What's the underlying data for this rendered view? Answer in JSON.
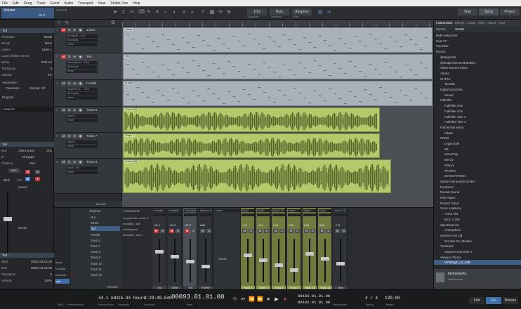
{
  "menu": [
    "File",
    "Edit",
    "Song",
    "Track",
    "Event",
    "Audio",
    "Transport",
    "View",
    "Studio One",
    "Help"
  ],
  "toolbar": {
    "inspector_track": "Volume",
    "inspector_value": "-21.2",
    "control_label": "Cmd/ctl",
    "quantize_value": "1/16",
    "quantize_label": "Quantize",
    "timebase_value": "Bars",
    "timebase_label": "Timebase",
    "snap_value": "Adaptive",
    "snap_label": "Snap",
    "start": "Start",
    "song": "Song",
    "project": "Project"
  },
  "inspector": {
    "track_name": "Ted",
    "rows": [
      {
        "k": "Timebase",
        "v": "Beats"
      },
      {
        "k": "Group",
        "v": "None"
      },
      {
        "k": "Layers",
        "v": "Layer 1"
      },
      {
        "k": "Layers follow events",
        "v": ""
      },
      {
        "k": "Delay",
        "v": "0.00 ms"
      },
      {
        "k": "Transpose",
        "v": "0"
      },
      {
        "k": "Velocity",
        "v": "0%"
      }
    ],
    "automation_label": "Automation",
    "automation_param": "Parameter",
    "automation_mode": "Display: Off",
    "program_label": "Program",
    "program_value": "Note FX",
    "channel_name": "Ted",
    "io": [
      {
        "k": "Out",
        "v": "Omni..ment",
        "v2": "Ch1"
      },
      {
        "k": "In",
        "v": "All Inputs",
        "v2": ""
      },
      {
        "k": "Channel",
        "v": "Ted",
        "v2": ""
      }
    ],
    "main_label": "Main",
    "vol": "-21.2",
    "pan": "<C>",
    "inserts_label": "Inserts",
    "sends_label": "Sends",
    "bottom_track": "Ted",
    "start_label": "Start",
    "start_val": "00001.01.01.00",
    "end_label": "End",
    "end_val": "00041.01.01.00",
    "transpose_label": "Transpose",
    "transpose_val": "0",
    "velocity_label": "Velocity",
    "velocity_val": "100%"
  },
  "tracks": [
    {
      "name": "Johan",
      "dev": "Kontakt5 - Ch1",
      "in": "All Inputs",
      "out": "None",
      "num": "1",
      "clip": "Johan",
      "kind": "inst"
    },
    {
      "name": "Ted",
      "dev": "Omnisphere - Ch1",
      "in": "All Inputs",
      "out": "None",
      "num": "2",
      "clip": "Ted",
      "kind": "inst"
    },
    {
      "name": "Fredrik",
      "dev": "Superior D... - Ch1",
      "in": "All Inputs",
      "out": "None",
      "num": "3",
      "clip": "Fredrik",
      "kind": "inst"
    },
    {
      "name": "Track 6",
      "dev": "Input L",
      "in": "None",
      "out": "",
      "num": "4",
      "clip": "Track 6(2)",
      "kind": "audio"
    },
    {
      "name": "Track 7",
      "dev": "Input L",
      "in": "None",
      "out": "",
      "num": "5",
      "clip": "Track 7",
      "kind": "audio"
    },
    {
      "name": "Track 8",
      "dev": "Input L+R",
      "in": "None",
      "out": "",
      "num": "6",
      "clip": "Track 8(2)",
      "kind": "audio"
    }
  ],
  "track_footer": "Medium",
  "browser": {
    "tabs": [
      "Instruments",
      "Effects",
      "Loops",
      "Files",
      "Cloud",
      "Pool"
    ],
    "sort_label": "Sort by:",
    "sort_val": "Vendor",
    "items": [
      {
        "t": "Multi Instrument",
        "lvl": 0,
        "sel": false
      },
      {
        "t": "Note FX",
        "lvl": 0,
        "sel": false
      },
      {
        "t": "Favorites",
        "lvl": 0,
        "sel": false
      },
      {
        "t": "Recent",
        "lvl": 0,
        "sel": false
      },
      {
        "t": "@Magnetel",
        "lvl": 1,
        "sel": false
      },
      {
        "t": "@Bridge/Steven Brambley",
        "lvl": 1,
        "sel": false
      },
      {
        "t": "Adam Monroe Music",
        "lvl": 1,
        "sel": false
      },
      {
        "t": "Arturia",
        "lvl": 1,
        "sel": false
      },
      {
        "t": "CHTEC",
        "lvl": 1,
        "sel": false
      },
      {
        "t": "Tamaka",
        "lvl": 2,
        "sel": false
      },
      {
        "t": "Digital Suburban",
        "lvl": 1,
        "sel": false
      },
      {
        "t": "Dexed",
        "lvl": 2,
        "sel": false
      },
      {
        "t": "FabFilter",
        "lvl": 1,
        "sel": false
      },
      {
        "t": "FabFilter One",
        "lvl": 2,
        "sel": false
      },
      {
        "t": "FabFilter One",
        "lvl": 2,
        "sel": false
      },
      {
        "t": "FabFilter Twin 2",
        "lvl": 2,
        "sel": false
      },
      {
        "t": "FabFilter Twin 3",
        "lvl": 2,
        "sel": false
      },
      {
        "t": "Full Bucket Music",
        "lvl": 1,
        "sel": false
      },
      {
        "t": "ndva4",
        "lvl": 2,
        "sel": false
      },
      {
        "t": "KORG",
        "lvl": 1,
        "sel": false
      },
      {
        "t": "LegacyCell",
        "lvl": 2,
        "sel": false
      },
      {
        "t": "M1",
        "lvl": 2,
        "sel": false
      },
      {
        "t": "MonoPoly",
        "lvl": 2,
        "sel": false
      },
      {
        "t": "MS-20",
        "lvl": 2,
        "sel": false
      },
      {
        "t": "Polysix",
        "lvl": 2,
        "sel": false
      },
      {
        "t": "TRITON",
        "lvl": 2,
        "sel": false
      },
      {
        "t": "WAVESTATION",
        "lvl": 2,
        "sel": false
      },
      {
        "t": "Native Instruments GmbH",
        "lvl": 1,
        "sel": false
      },
      {
        "t": "PreSonus",
        "lvl": 1,
        "sel": false
      },
      {
        "t": "Reveal Sound",
        "lvl": 1,
        "sel": false
      },
      {
        "t": "Rob Papen",
        "lvl": 1,
        "sel": false
      },
      {
        "t": "Roland Cloud",
        "lvl": 1,
        "sel": false
      },
      {
        "t": "Sonic Academy",
        "lvl": 1,
        "sel": false
      },
      {
        "t": "ANA2 x64",
        "lvl": 2,
        "sel": false
      },
      {
        "t": "KICK 2 x64",
        "lvl": 2,
        "sel": false
      },
      {
        "t": "Spectrasonics",
        "lvl": 1,
        "sel": false
      },
      {
        "t": "Omnisphere",
        "lvl": 2,
        "sel": false
      },
      {
        "t": "Synthes Arts Ltd",
        "lvl": 1,
        "sel": false
      },
      {
        "t": "Revolve Pro Monitor",
        "lvl": 2,
        "sel": false
      },
      {
        "t": "Toontrack",
        "lvl": 1,
        "sel": false
      },
      {
        "t": "Superior Drummer 3",
        "lvl": 2,
        "sel": false
      },
      {
        "t": "Vengeur Studio",
        "lvl": 1,
        "sel": false
      },
      {
        "t": "VSTplugin_x1_64B",
        "lvl": 2,
        "sel": true
      }
    ],
    "footer_title": "Instruments",
    "footer_sub": "Instruments"
  },
  "console": {
    "list_header": "Channel",
    "list": [
      "Out",
      "Johan",
      "Ted",
      "Fredrik",
      "Track 6",
      "Track 7",
      "Track 8",
      "Track 9",
      "Track 10",
      "Track 11",
      "Track 12"
    ],
    "side": [
      "Input",
      "Outputs",
      "External",
      "Instr"
    ],
    "remote": "Remote",
    "instruments_header": "Instruments",
    "instr_list": [
      "Superior Dru..mmer 3",
      "Kontakt5 - x64",
      "Omnisphere",
      "Kontakt5 - x64 2"
    ],
    "strips": [
      {
        "top": "Kontakt5 - Omni",
        "vol": "-21.1",
        "label": "Out",
        "kind": "gray"
      },
      {
        "top": "Kontakt5 - v1",
        "vol": "-21.2",
        "label": "Johan",
        "kind": "gray"
      },
      {
        "top": "Omnisphere",
        "vol": "-21.2",
        "label": "Ted",
        "kind": "sel"
      },
      {
        "top": "Superior Drum",
        "vol": "0dB",
        "label": "Fredrik",
        "kind": "gray"
      },
      {
        "top": "Inserts",
        "vol": "",
        "label": "",
        "kind": "empty"
      },
      {
        "top": "Input L",
        "vol": "-3.9",
        "label": "Track 6",
        "kind": "green"
      },
      {
        "top": "Input L",
        "vol": "-2.8",
        "label": "Track 7",
        "kind": "green"
      },
      {
        "top": "Input L+R",
        "vol": "0dB",
        "label": "Track 8",
        "kind": "green"
      },
      {
        "top": "Input L",
        "vol": "0dB",
        "label": "Track 9",
        "kind": "green"
      },
      {
        "top": "Input L",
        "vol": "0dB",
        "label": "Track 10",
        "kind": "green"
      },
      {
        "top": "Input L",
        "vol": "0dB",
        "label": "Track 11",
        "kind": "green"
      },
      {
        "top": "Audio 1/2L",
        "vol": "-7.8",
        "label": "Main",
        "kind": "gray"
      }
    ],
    "sends": "Sends"
  },
  "transport": {
    "midi": "MIDI",
    "performance": "Performance",
    "rate": "44.1 kHz",
    "rate_sub": "Record Max",
    "time": "15.33 hours",
    "time_sub": "Seconds",
    "counter1": "2:29:49.840",
    "counter1_sub": "Seconds",
    "position": "00093.01.01.00",
    "position_sub": "Bars",
    "loop_start": "00102.01.01.00",
    "loop_end": "00102.01.01.00",
    "metronome": "Metronome",
    "signature": "4 / 4",
    "timing": "Timing",
    "tempo": "130.00",
    "tempo_label": "Tempo",
    "edit": "Edit",
    "mix": "Mix",
    "browse": "Browse"
  }
}
